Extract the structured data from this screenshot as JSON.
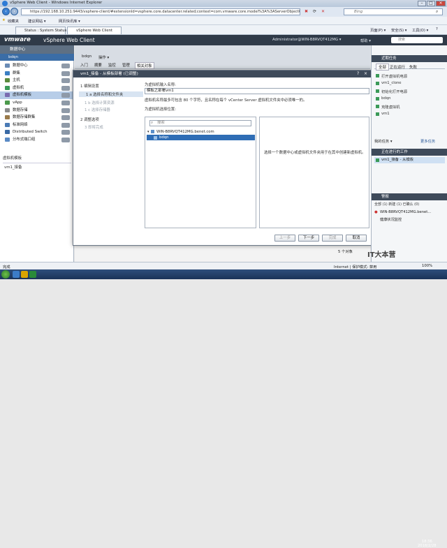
{
  "browser": {
    "title": "vSphere Web Client - Windows Internet Explorer",
    "url": "https://192.168.10.251:9443/vsphere-client/#extensionId=vsphere.core.datacenter.related;context=com.vmware.core.model%3A%3AServerObjectRef~83B71A82",
    "search_placeholder": "Bing",
    "favorites_label": "收藏夹",
    "fav_items": [
      "建议网站 ▾",
      "网页快讯库 ▾"
    ],
    "tabs": [
      "Status : System Status",
      "vSphere Web Client"
    ],
    "tools": [
      "页面(P) ▾",
      "安全(S) ▾",
      "工具(O) ▾"
    ],
    "status_text": "完成",
    "zone_text": "Internet | 保护模式: 禁用",
    "zoom_text": "100%"
  },
  "app": {
    "logo": "vmware",
    "product": "vSphere Web Client",
    "user": "Administrator@WIN-B8RVQT412MG ▾",
    "help": "帮助 ▾",
    "search_placeholder": "搜索"
  },
  "left": {
    "nav_title": "数据中心",
    "context": "bdqn",
    "items": [
      {
        "label": "数据中心",
        "color": "#6a8bb5"
      },
      {
        "label": "群集",
        "color": "#3c7fc4"
      },
      {
        "label": "主机",
        "color": "#5a8a3c"
      },
      {
        "label": "虚拟机",
        "color": "#3b9a58"
      },
      {
        "label": "虚拟机模板",
        "color": "#7a6bb0",
        "selected": true
      },
      {
        "label": "vApp",
        "color": "#4c9a4c"
      },
      {
        "label": "数据存储",
        "color": "#8b8b8b"
      },
      {
        "label": "数据存储群集",
        "color": "#9a7a4a"
      },
      {
        "label": "标准网络",
        "color": "#4a7ab5"
      },
      {
        "label": "Distributed Switch",
        "color": "#3a6aa5"
      },
      {
        "label": "分布式端口组",
        "color": "#5a8ac5"
      }
    ],
    "section_label": "虚拟机模板",
    "section_item": "vm1_接备"
  },
  "center": {
    "breadcrumb": "bdqn",
    "actions": "操作 ▾",
    "tabs": [
      "入门",
      "摘要",
      "监控",
      "管理",
      "相关对象"
    ]
  },
  "modal": {
    "title": "vm1_接备 - 从模板部署 (已调整)",
    "steps": [
      {
        "label": "1 编辑设置",
        "state": "header"
      },
      {
        "label": "1 a  选择名称和文件夹",
        "state": "current"
      },
      {
        "label": "1 b  选择计算资源",
        "state": "dim"
      },
      {
        "label": "1 c  选择存储器",
        "state": "dim"
      },
      {
        "label": "2 调整选项",
        "state": "header"
      },
      {
        "label": "3 即将完成",
        "state": "dim"
      }
    ],
    "name_label": "为虚拟机输入名称:",
    "name_value": "模板之部署vm1",
    "name_hint": "虚拟机名称最多可包含 80 个字符，且名称在每个 vCenter Server 虚拟机文件夹中必须唯一的。",
    "location_label": "为虚拟机选择位置:",
    "tree_search_placeholder": "搜索",
    "tree_root": "WIN-B8RVQT412MG.benet.com",
    "tree_child": "bdqn",
    "info_text": "选择一个数据中心或虚拟机文件夹用于在其中创建新虚拟机。",
    "buttons": {
      "back": "上一步",
      "next": "下一步",
      "finish": "完成",
      "cancel": "取消"
    },
    "items_count": "5 个对象"
  },
  "right": {
    "tasks_title": "近期任务",
    "task_tabs": [
      "全部",
      "正在运行",
      "失败"
    ],
    "tasks": [
      "打开虚拟机电源",
      "vm1_clone",
      "初始化打开电源",
      "bdqn",
      "克隆虚拟机",
      "vm1"
    ],
    "my_tasks": "我的任务 ▾",
    "more_tasks": "更多任务",
    "progress_title": "正在进行的工作",
    "progress_item": "vm1_接备 - 从模板",
    "alarms_title": "警报",
    "alarms_tabs": "全部 (1)  新建 (1)  已确认 (0)",
    "alarm_host": "WIN-B8RVQT412MG.benet...",
    "alarm_text": "健康状况监控"
  },
  "taskbar": {
    "watermark": "IT大本营",
    "clock": "18:36\n2018/2/28"
  }
}
